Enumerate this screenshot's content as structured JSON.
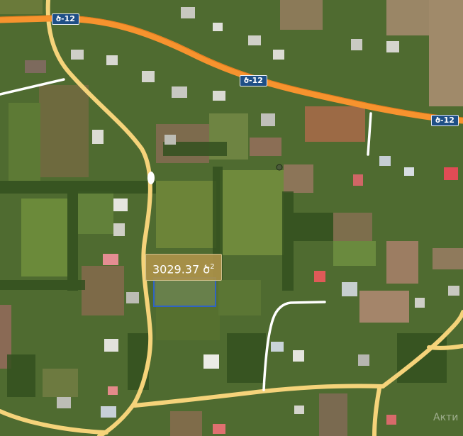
{
  "map": {
    "road_shields": [
      "ծ-12",
      "ծ-12",
      "ծ-12"
    ],
    "area_measurement": {
      "value": "3029.37",
      "unit": "ծ",
      "exponent": "2"
    },
    "watermark": "Акти"
  },
  "colors": {
    "highway": "#f7932e",
    "local_road": "#f5d37a",
    "white_road": "#ffffff",
    "measurement_outline": "#2f63c4",
    "label_background": "#ad934a"
  }
}
